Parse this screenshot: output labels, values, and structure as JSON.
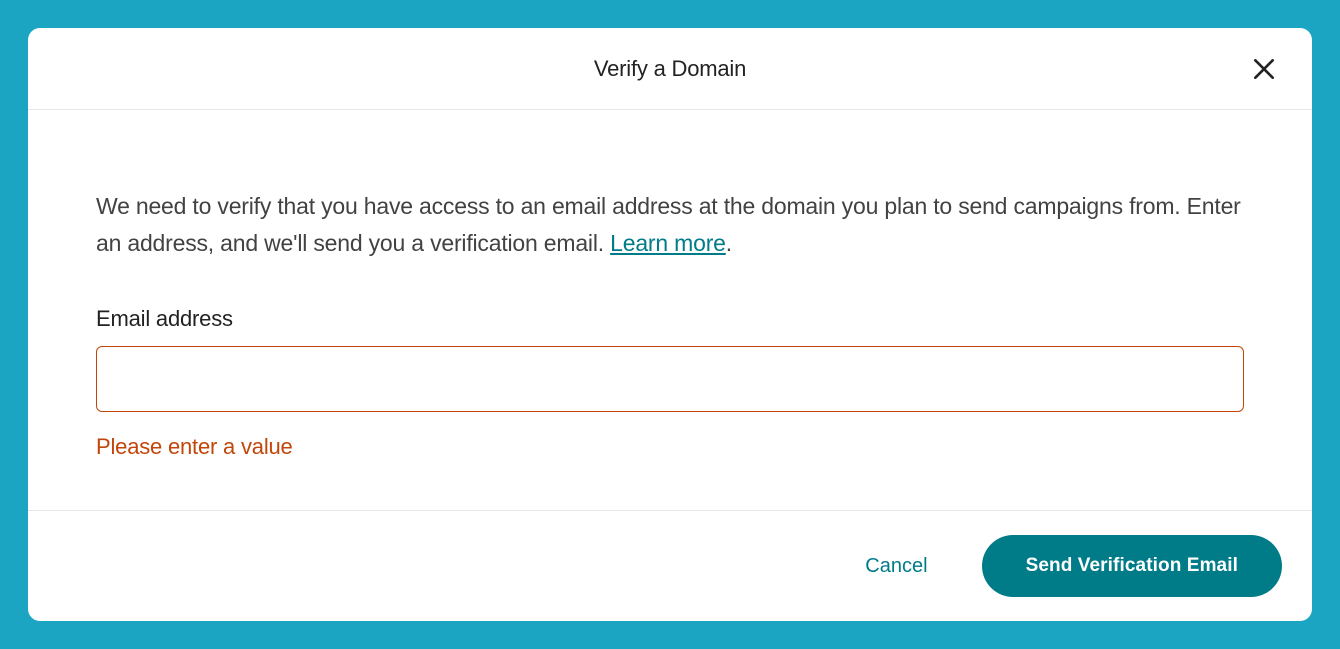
{
  "modal": {
    "title": "Verify a Domain",
    "description_text": "We need to verify that you have access to an email address at the domain you plan to send campaigns from. Enter an address, and we'll send you a verification email. ",
    "learn_more_label": "Learn more",
    "period": ".",
    "field": {
      "label": "Email address",
      "value": "",
      "error": "Please enter a value"
    },
    "footer": {
      "cancel_label": "Cancel",
      "submit_label": "Send Verification Email"
    }
  },
  "colors": {
    "backdrop": "#1ba5c2",
    "accent": "#007c89",
    "error": "#c2460a"
  }
}
